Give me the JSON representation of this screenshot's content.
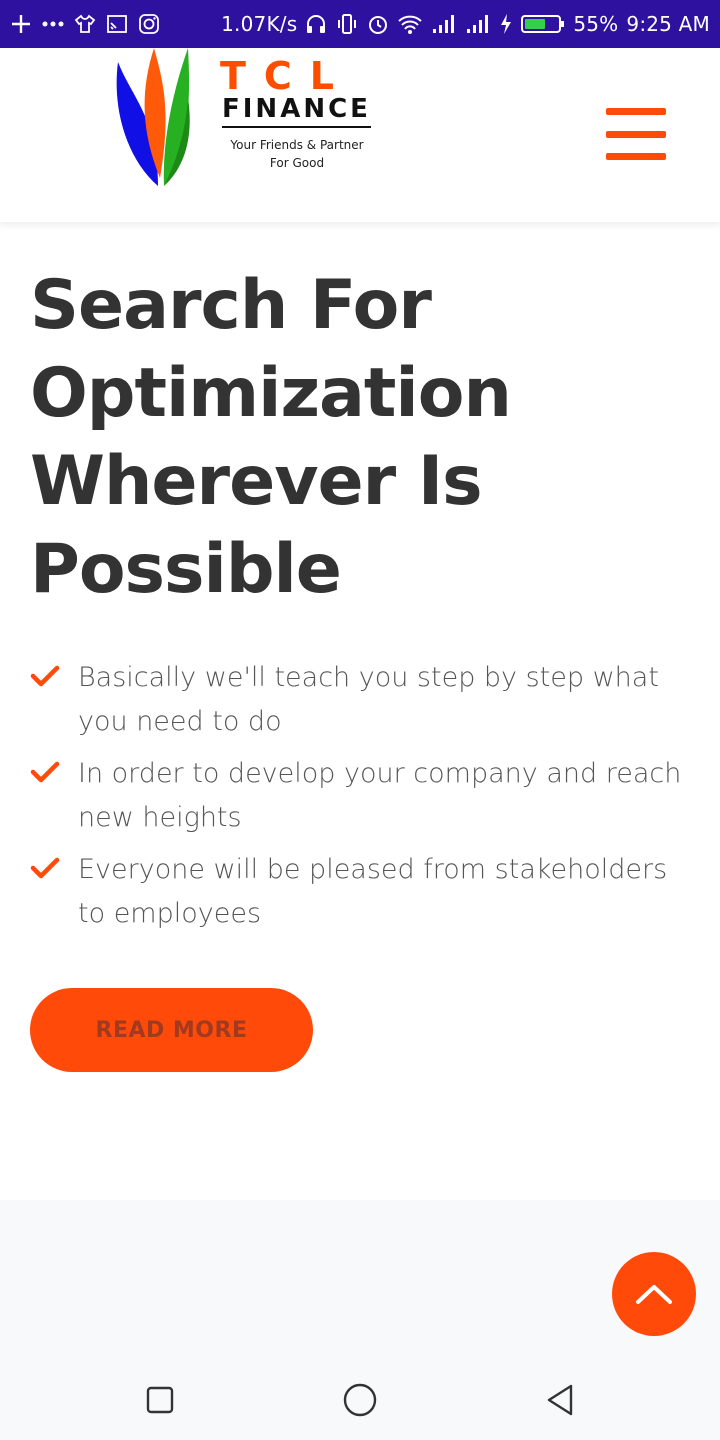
{
  "status_bar": {
    "net_speed": "1.07K/s",
    "battery": "55%",
    "time": "9:25 AM",
    "color": "#2f11a0"
  },
  "header": {
    "logo": {
      "name": "TCL",
      "finance": "FINANCE",
      "tagline_1": "Your Friends & Partner",
      "tagline_2": "For Good"
    },
    "menu_icon": "hamburger-icon",
    "accent_color": "#ff4a0a"
  },
  "hero": {
    "title_lines": [
      "Search For",
      "Optimization",
      "Wherever Is",
      "Possible"
    ]
  },
  "features": [
    {
      "text": "Basically we'll teach you step by step what you need to do"
    },
    {
      "text": "In order to develop your company and reach new heights"
    },
    {
      "text": "Everyone will be pleased from stakeholders to employees"
    }
  ],
  "cta": {
    "read_more_label": "READ MORE"
  },
  "back_to_top_icon": "chevron-up-icon",
  "nav_bar": {
    "icons": [
      "recent-apps-icon",
      "home-icon",
      "back-icon"
    ]
  }
}
